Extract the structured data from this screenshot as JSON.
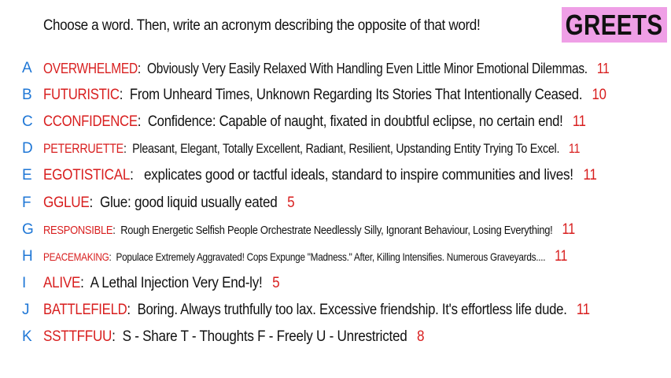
{
  "logo": {
    "text": "GREETS"
  },
  "prompt": "Choose a word. Then, write an acronym describing the opposite of that word!",
  "colors": {
    "letter": "#1f77d6",
    "word": "#d81e1e",
    "count": "#d81e1e",
    "logo_bg": "#ef9fe6"
  },
  "entries": [
    {
      "letter": "A",
      "word": "OVERWHELMED",
      "definition": "Obviously Very Easily Relaxed With Handling Even Little Minor Emotional Dilemmas.",
      "count": "11"
    },
    {
      "letter": "B",
      "word": "FUTURISTIC",
      "definition": "From Unheard Times, Unknown Regarding Its Stories That Intentionally Ceased.",
      "count": "10"
    },
    {
      "letter": "C",
      "word": "CCONFIDENCE",
      "definition": "Confidence: Capable of naught, fixated in doubtful eclipse, no certain end!",
      "count": "11"
    },
    {
      "letter": "D",
      "word": "PETERRUETTE",
      "definition": "Pleasant, Elegant, Totally Excellent, Radiant, Resilient, Upstanding Entity Trying To Excel.",
      "count": "11"
    },
    {
      "letter": "E",
      "word": "EGOTISTICAL",
      "definition": " explicates good or tactful ideals, standard to inspire communities and lives!",
      "count": "11"
    },
    {
      "letter": "F",
      "word": "GGLUE",
      "definition": "Glue: good liquid usually eated",
      "count": "5"
    },
    {
      "letter": "G",
      "word": "RESPONSIBLE",
      "definition": "Rough Energetic Selfish People Orchestrate Needlessly Silly, Ignorant Behaviour, Losing Everything!",
      "count": "11"
    },
    {
      "letter": "H",
      "word": "PEACEMAKING",
      "definition": "Populace Extremely Aggravated! Cops Expunge \"Madness.\" After, Killing Intensifies. Numerous Graveyards....",
      "count": "11"
    },
    {
      "letter": "I",
      "word": "ALIVE",
      "definition": "A Lethal Injection Very End-ly!",
      "count": "5"
    },
    {
      "letter": "J",
      "word": "BATTLEFIELD",
      "definition": "Boring. Always truthfully too lax. Excessive friendship. It's effortless life dude.",
      "count": "11"
    },
    {
      "letter": "K",
      "word": "SSTTFFUU",
      "definition": "S - Share T - Thoughts F - Freely U - Unrestricted",
      "count": "8"
    }
  ]
}
